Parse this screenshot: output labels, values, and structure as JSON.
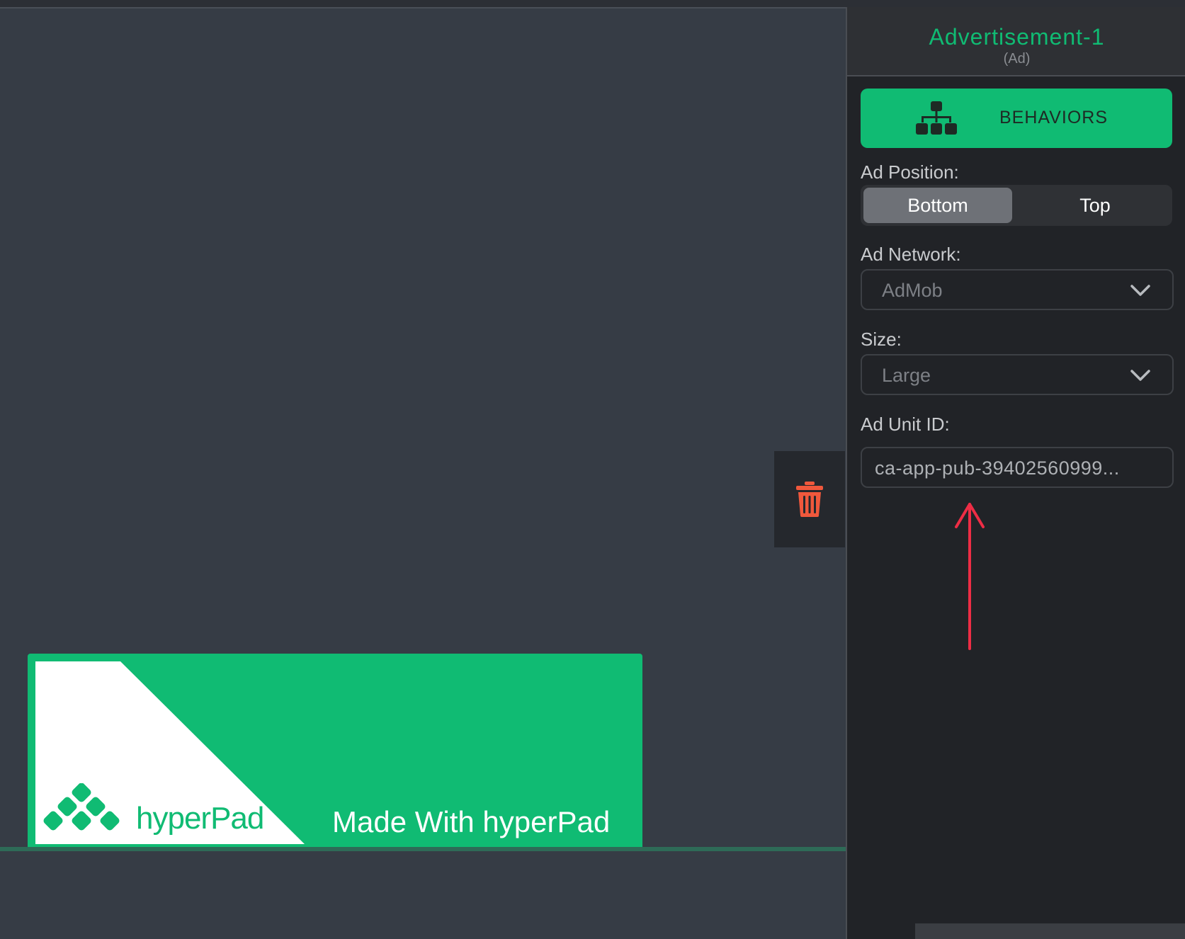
{
  "inspector": {
    "title": "Advertisement-1",
    "subtitle": "(Ad)",
    "behaviors_label": "BEHAVIORS",
    "ad_position": {
      "label": "Ad Position:",
      "options": [
        "Bottom",
        "Top"
      ],
      "selected": "Bottom"
    },
    "ad_network": {
      "label": "Ad Network:",
      "value": "AdMob"
    },
    "size": {
      "label": "Size:",
      "value": "Large"
    },
    "ad_unit_id": {
      "label": "Ad Unit ID:",
      "value": "ca-app-pub-39402560999..."
    }
  },
  "ad_banner": {
    "logo_text_light": "hyper",
    "logo_text_bold": "Pad",
    "tagline": "Made With hyperPad"
  },
  "icons": {
    "behaviors": "hierarchy-icon",
    "delete": "trash-icon",
    "dropdown": "chevron-down-icon",
    "annotation": "red-arrow-up"
  },
  "colors": {
    "accent_green": "#10bb73",
    "delete_red": "#f0583c",
    "annotation_red": "#ee2d45"
  }
}
